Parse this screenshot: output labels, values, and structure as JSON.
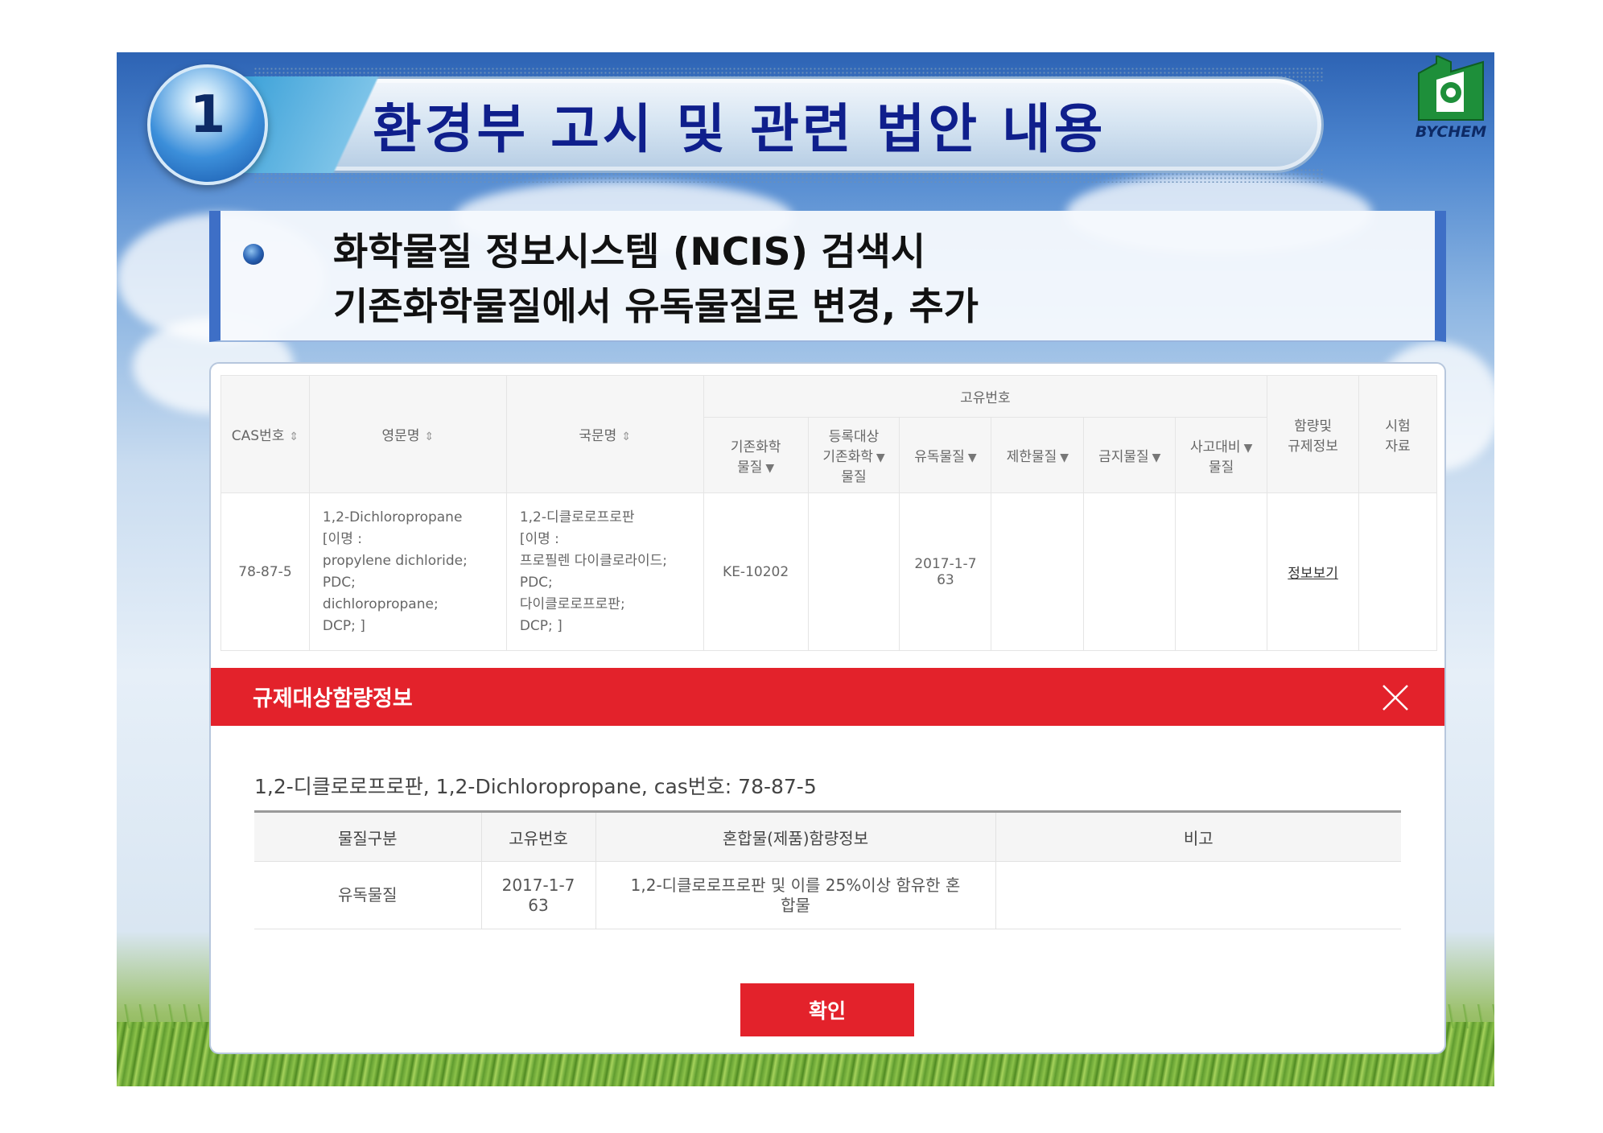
{
  "slide": {
    "number": "1",
    "title": "환경부 고시 및 관련 법안 내용",
    "logo_text": "BYCHEM",
    "subtitle_line1": "화학물질 정보시스템 (NCIS) 검색시",
    "subtitle_line2": "기존화학물질에서 유독물질로 변경, 추가"
  },
  "ncis_table": {
    "headers": {
      "cas": "CAS번호",
      "english_name": "영문명",
      "korean_name": "국문명",
      "unique_no": "고유번호",
      "existing": "기존화학물질",
      "registration_target": "등록대상기존화학물질",
      "toxic": "유독물질",
      "restricted": "제한물질",
      "prohibited": "금지물질",
      "accident": "사고대비물질",
      "content_info": "함량및규제정보",
      "test_data": "시험자료"
    },
    "row": {
      "cas": "78-87-5",
      "english_lines": [
        "1,2-Dichloropropane",
        "[이명 :",
        "propylene dichloride;",
        "PDC;",
        "dichloropropane;",
        "DCP; ]"
      ],
      "korean_lines": [
        "1,2-디클로로프로판",
        "[이명 :",
        "프로필렌 다이클로라이드;",
        "PDC;",
        "다이클로로프로판;",
        "DCP; ]"
      ],
      "existing": "KE-10202",
      "toxic_line1": "2017-1-7",
      "toxic_line2": "63",
      "content_link": "정보보기"
    }
  },
  "modal": {
    "title": "규제대상함량정보",
    "substance": "1,2-디클로로프로판, 1,2-Dichloropropane, cas번호: 78-87-5",
    "headers": [
      "물질구분",
      "고유번호",
      "혼합물(제품)함량정보",
      "비고"
    ],
    "row": {
      "category": "유독물질",
      "id_line1": "2017-1-7",
      "id_line2": "63",
      "content_line1": "1,2-디클로로프로판 및 이를 25%이상 함유한 혼",
      "content_line2": "합물",
      "note": ""
    },
    "confirm_label": "확인"
  },
  "colors": {
    "title_blue": "#0f1f8c",
    "modal_red": "#e3222b",
    "accent_blue": "#3e6fc6"
  }
}
